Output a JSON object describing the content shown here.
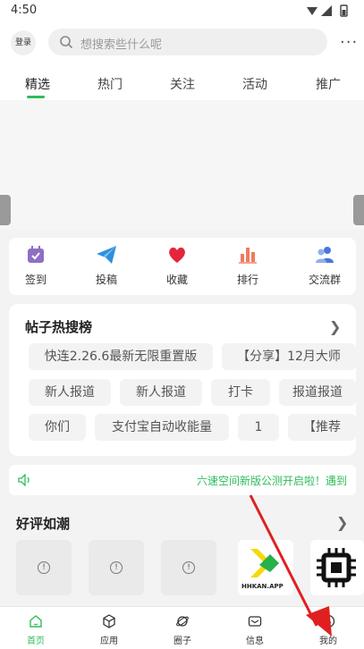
{
  "status_bar": {
    "time": "4:50"
  },
  "header": {
    "login_label": "登录",
    "search_placeholder": "想搜索些什么呢",
    "more_label": "···"
  },
  "tabs": [
    {
      "label": "精选",
      "active": true
    },
    {
      "label": "热门"
    },
    {
      "label": "关注"
    },
    {
      "label": "活动"
    },
    {
      "label": "推广"
    }
  ],
  "quick_menu": [
    {
      "label": "签到",
      "icon": "calendar-icon"
    },
    {
      "label": "投稿",
      "icon": "paper-plane-icon"
    },
    {
      "label": "收藏",
      "icon": "heart-icon"
    },
    {
      "label": "排行",
      "icon": "bar-chart-icon"
    },
    {
      "label": "交流群",
      "icon": "users-icon"
    }
  ],
  "hot_posts": {
    "title": "帖子热搜榜",
    "chips": [
      "快连2.26.6最新无限重置版",
      "【分享】12月大师",
      "新人报道",
      "新人报道",
      "打卡",
      "报道报道",
      "你们",
      "支付宝自动收能量",
      "1",
      "【推荐"
    ]
  },
  "notice": {
    "text": "六速空间新版公测开启啦！遇到"
  },
  "good_reviews": {
    "title": "好评如潮",
    "cards": [
      "",
      "",
      "",
      "HHKAN.APP",
      "chip-icon"
    ]
  },
  "bottom_nav": [
    {
      "label": "首页",
      "active": true
    },
    {
      "label": "应用"
    },
    {
      "label": "圈子"
    },
    {
      "label": "信息"
    },
    {
      "label": "我的"
    }
  ],
  "colors": {
    "accent": "#2dbd5a",
    "annotation": "#e02020"
  }
}
